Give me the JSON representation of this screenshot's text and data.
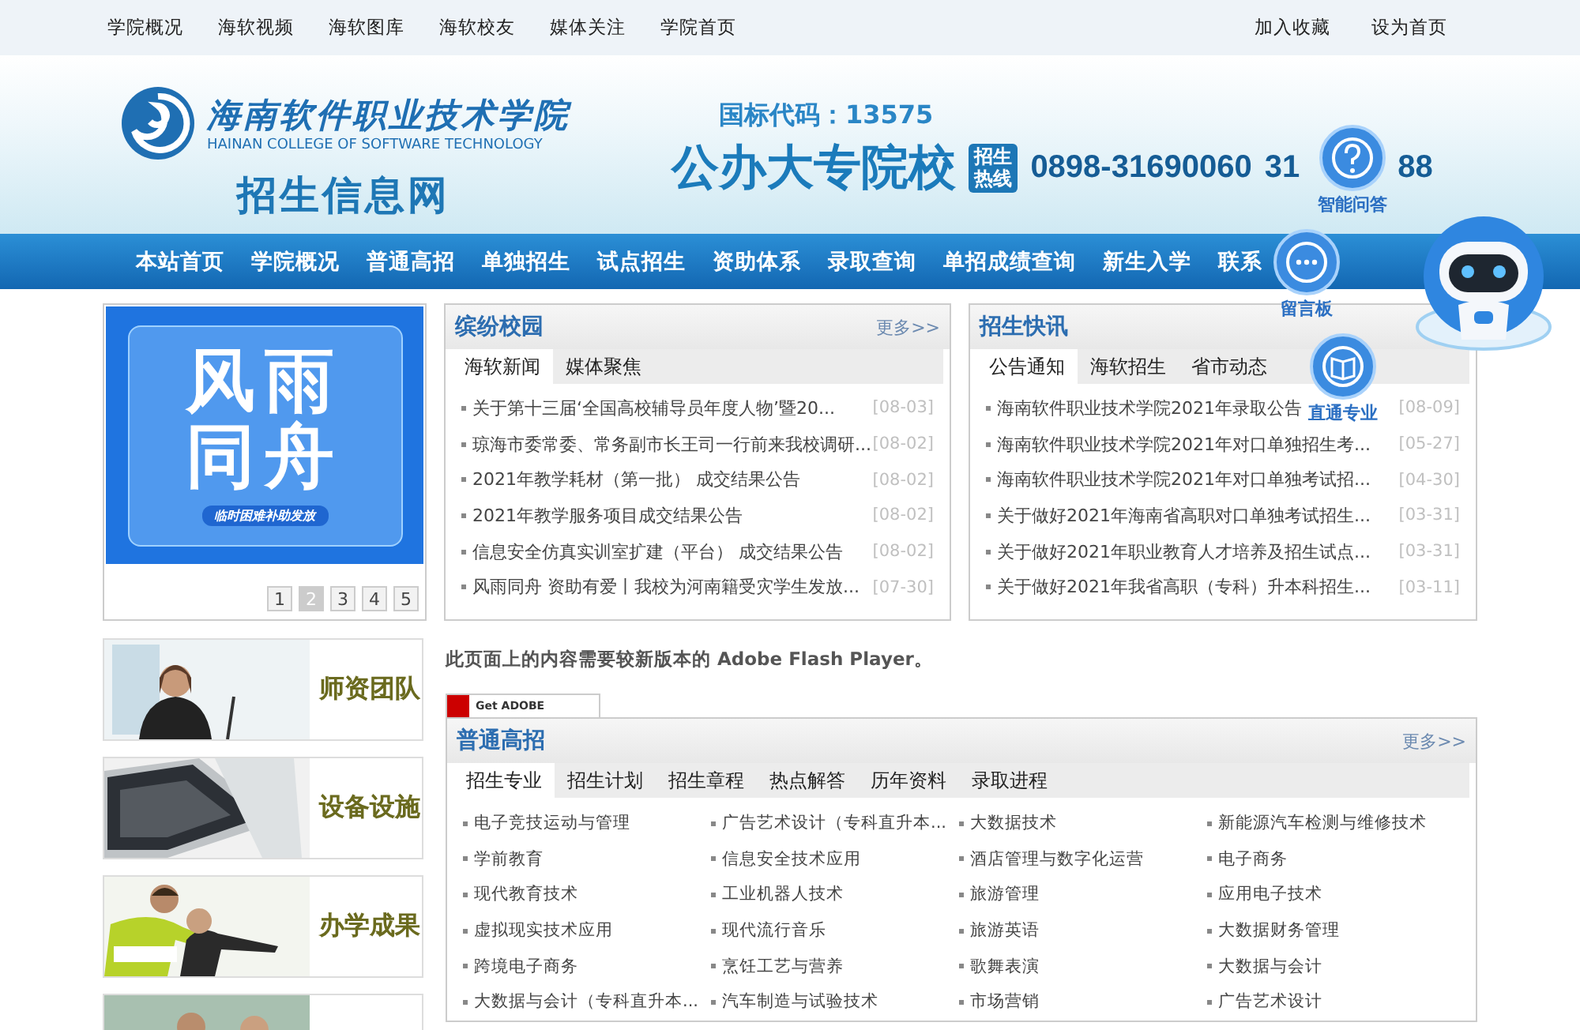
{
  "top_links": [
    "学院概况",
    "海软视频",
    "海软图库",
    "海软校友",
    "媒体关注",
    "学院首页"
  ],
  "top_right": [
    "加入收藏",
    "设为首页"
  ],
  "header": {
    "school_name": "海南软件职业技术学院",
    "school_name_en": "HAINAN COLLEGE OF SOFTWARE TECHNOLOGY",
    "site_title": "招生信息网",
    "code": "国标代码：13575",
    "type": "公办大专院校",
    "hotline_label": "招生热线",
    "phone": "0898-31690060",
    "phone_2a": "31",
    "phone_2b": "88"
  },
  "nav": [
    "本站首页",
    "学院概况",
    "普通高招",
    "单独招生",
    "试点招生",
    "资助体系",
    "录取查询",
    "单招成绩查询",
    "新生入学",
    "联系"
  ],
  "float_widget": [
    {
      "kind": "question",
      "label": "智能问答"
    },
    {
      "kind": "chat",
      "label": "留言板"
    },
    {
      "kind": "book",
      "label": "直通专业"
    },
    {
      "kind": "robot"
    }
  ],
  "slideshow": {
    "title_lines": [
      "风雨",
      "同舟"
    ],
    "subtitle": "临时困难补助发放",
    "pages": [
      {
        "label": "1",
        "selected": false
      },
      {
        "label": "2",
        "selected": true
      },
      {
        "label": "3",
        "selected": false
      },
      {
        "label": "4",
        "selected": false
      },
      {
        "label": "5",
        "selected": false
      }
    ]
  },
  "campus": {
    "title": "缤纷校园",
    "more": "更多>>",
    "tabs": [
      {
        "label": "海软新闻",
        "selected": true
      },
      {
        "label": "媒体聚焦",
        "selected": false
      }
    ],
    "items": [
      {
        "text": "关于第十三届‘全国高校辅导员年度人物’暨20...",
        "date": "[08-03]"
      },
      {
        "text": "琼海市委常委、常务副市长王司一行前来我校调研...",
        "date": "[08-02]"
      },
      {
        "text": "2021年教学耗材（第一批） 成交结果公告",
        "date": "[08-02]"
      },
      {
        "text": "2021年教学服务项目成交结果公告",
        "date": "[08-02]"
      },
      {
        "text": "信息安全仿真实训室扩建（平台） 成交结果公告",
        "date": "[08-02]"
      },
      {
        "text": "风雨同舟 资助有爱丨我校为河南籍受灾学生发放...",
        "date": "[07-30]"
      }
    ]
  },
  "news": {
    "title": "招生快讯",
    "tabs": [
      {
        "label": "公告通知",
        "selected": true
      },
      {
        "label": "海软招生",
        "selected": false
      },
      {
        "label": "省市动态",
        "selected": false
      }
    ],
    "items": [
      {
        "text": "海南软件职业技术学院2021年录取公告",
        "date": "[08-09]"
      },
      {
        "text": "海南软件职业技术学院2021年对口单独招生考...",
        "date": "[05-27]"
      },
      {
        "text": "海南软件职业技术学院2021年对口单独考试招...",
        "date": "[04-30]"
      },
      {
        "text": "关于做好2021年海南省高职对口单独考试招生...",
        "date": "[03-31]"
      },
      {
        "text": "关于做好2021年职业教育人才培养及招生试点...",
        "date": "[03-31]"
      },
      {
        "text": "关于做好2021年我省高职（专科）升本科招生...",
        "date": "[03-11]"
      }
    ]
  },
  "features": [
    {
      "kind": "teacher",
      "label": "师资团队"
    },
    {
      "kind": "laptop",
      "label": "设备设施"
    },
    {
      "kind": "people",
      "label": "办学成果"
    },
    {
      "kind": "picture"
    }
  ],
  "flash": {
    "notice": "此页面上的内容需要较新版本的 Adobe Flash Player。",
    "badge": "Get ADOBE"
  },
  "admissions": {
    "title": "普通高招",
    "more": "更多>>",
    "tabs": [
      {
        "label": "招生专业",
        "selected": true
      },
      {
        "label": "招生计划",
        "selected": false
      },
      {
        "label": "招生章程",
        "selected": false
      },
      {
        "label": "热点解答",
        "selected": false
      },
      {
        "label": "历年资料",
        "selected": false
      },
      {
        "label": "录取进程",
        "selected": false
      }
    ],
    "majors": [
      "电子竞技运动与管理",
      "广告艺术设计（专科直升本...",
      "大数据技术",
      "新能源汽车检测与维修技术",
      "学前教育",
      "信息安全技术应用",
      "酒店管理与数字化运营",
      "电子商务",
      "现代教育技术",
      "工业机器人技术",
      "旅游管理",
      "应用电子技术",
      "虚拟现实技术应用",
      "现代流行音乐",
      "旅游英语",
      "大数据财务管理",
      "跨境电子商务",
      "烹饪工艺与营养",
      "歌舞表演",
      "大数据与会计",
      "大数据与会计（专科直升本...",
      "汽车制造与试验技术",
      "市场营销",
      "广告艺术设计"
    ]
  }
}
